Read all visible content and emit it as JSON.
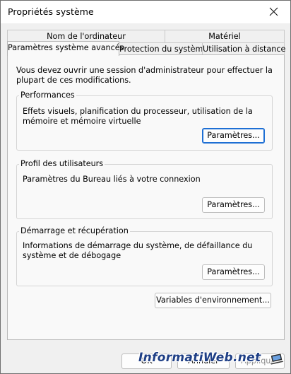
{
  "window": {
    "title": "Propriétés système"
  },
  "tabs": {
    "computer_name": "Nom de l'ordinateur",
    "hardware": "Matériel",
    "advanced": "Paramètres système avancés",
    "protection": "Protection du système",
    "remote": "Utilisation à distance"
  },
  "panel": {
    "admin_notice": "Vous devez ouvrir une session d'administrateur pour effectuer la plupart de ces modifications.",
    "performance": {
      "label": "Performances",
      "description": "Effets visuels, planification du processeur, utilisation de la mémoire et mémoire virtuelle",
      "button": "Paramètres..."
    },
    "user_profiles": {
      "label": "Profil des utilisateurs",
      "description": "Paramètres du Bureau liés à votre connexion",
      "button": "Paramètres..."
    },
    "startup_recovery": {
      "label": "Démarrage et récupération",
      "description": "Informations de démarrage du système, de défaillance du système et de débogage",
      "button": "Paramètres..."
    },
    "env_button": "Variables d'environnement..."
  },
  "footer": {
    "ok": "OK",
    "cancel": "Annuler",
    "apply": "Appliquer"
  },
  "watermark": {
    "text": "InformatiWeb.net"
  },
  "colors": {
    "focus": "#1e6fd4",
    "watermark": "#1f3f86"
  }
}
